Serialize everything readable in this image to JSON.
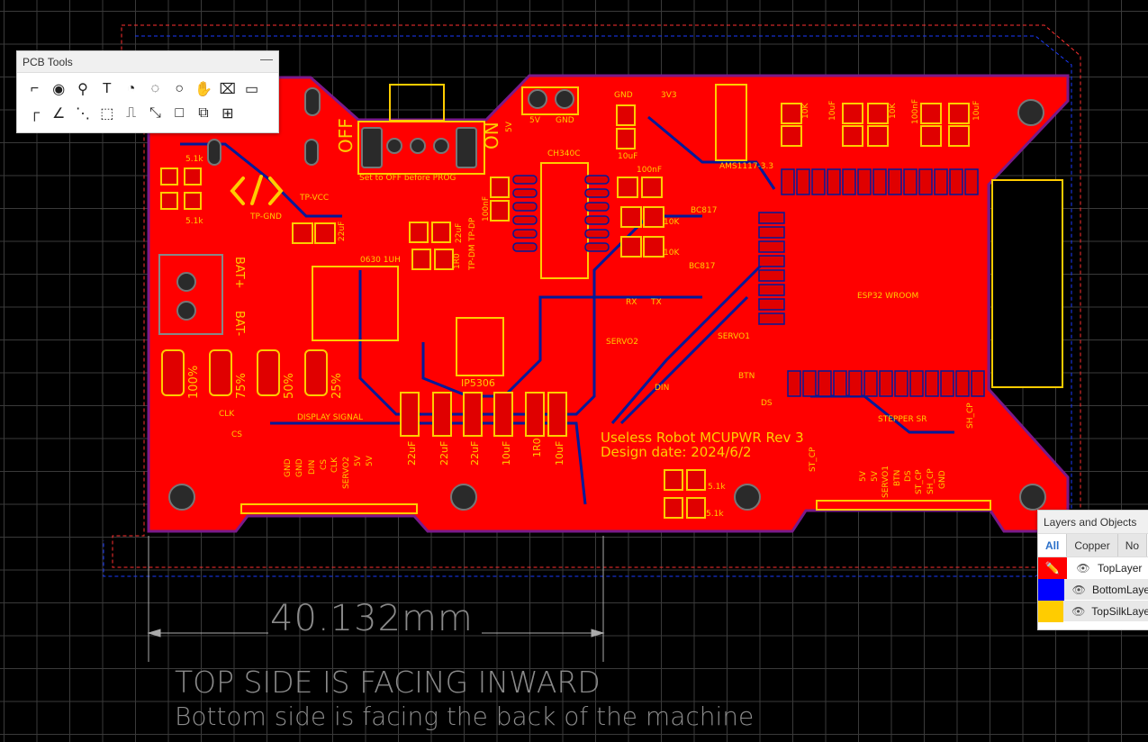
{
  "colors": {
    "top_layer": "#ff0000",
    "bottom_layer": "#0000ff",
    "top_silk": "#ffcc00",
    "board_outline": "#7a1a8a",
    "background": "#000000"
  },
  "pcb_tools": {
    "title": "PCB Tools",
    "minimize_icon": "minus-icon",
    "tools": [
      {
        "name": "route-track-icon",
        "glyph": "⌐"
      },
      {
        "name": "via-icon",
        "glyph": "◉"
      },
      {
        "name": "pad-icon",
        "glyph": "⚲"
      },
      {
        "name": "text-icon",
        "glyph": "T"
      },
      {
        "name": "arc-icon",
        "glyph": "◔"
      },
      {
        "name": "arc-center-icon",
        "glyph": "◌"
      },
      {
        "name": "circle-icon",
        "glyph": "○"
      },
      {
        "name": "pan-hand-icon",
        "glyph": "✋"
      },
      {
        "name": "pad-cross-icon",
        "glyph": "⌧"
      },
      {
        "name": "image-icon",
        "glyph": "▭"
      },
      {
        "name": "dimension-icon",
        "glyph": "┌"
      },
      {
        "name": "angle-icon",
        "glyph": "∠"
      },
      {
        "name": "connect-icon",
        "glyph": "⋱"
      },
      {
        "name": "region-icon",
        "glyph": "⬚"
      },
      {
        "name": "polygon-icon",
        "glyph": "⎍"
      },
      {
        "name": "measure-icon",
        "glyph": "⤡"
      },
      {
        "name": "rectangle-icon",
        "glyph": "□"
      },
      {
        "name": "group-icon",
        "glyph": "⧉"
      },
      {
        "name": "table-icon",
        "glyph": "⊞"
      }
    ]
  },
  "layers_panel": {
    "title": "Layers and Objects",
    "tabs": [
      "All",
      "Copper",
      "No"
    ],
    "layers": [
      {
        "name": "TopLayer",
        "color": "#ff0000",
        "active": true
      },
      {
        "name": "BottomLayer",
        "color": "#0000ff"
      },
      {
        "name": "TopSilkLayer",
        "color": "#ffcc00"
      }
    ]
  },
  "dimension": {
    "text": "40.132mm"
  },
  "notes": {
    "line1": "TOP SIDE IS FACING INWARD",
    "line2": "Bottom side is facing the back of the machine"
  },
  "silk": [
    "OFF",
    "ON",
    "Set to OFF before PROG",
    "5V",
    "5V",
    "GND",
    "CH340C",
    "5.1k",
    "5.1k",
    "TP-VCC",
    "TP-GND",
    "22uF",
    "22uF",
    "100nF",
    "TP-DP",
    "TP-DM",
    "0630 1UH",
    "1R0",
    "BAT+",
    "BAT-",
    "100%",
    "75%",
    "50%",
    "25%",
    "CLK",
    "CS",
    "DISPLAY SIGNAL",
    "GND",
    "GND",
    "DIN",
    "CS",
    "CLK",
    "SERVO2",
    "5V",
    "5V",
    "IP5306",
    "22uF",
    "22uF",
    "22uF",
    "10uF",
    "1R0",
    "10uF",
    "GND",
    "3V3",
    "10uF",
    "100nF",
    "AMS1117-3.3",
    "10K",
    "10uF",
    "10K",
    "100nF",
    "10uF",
    "BC817",
    "10K",
    "10K",
    "BC817",
    "ESP32 WROOM",
    "RX",
    "TX",
    "SERVO2",
    "SERVO1",
    "BTN",
    "DIN",
    "DS",
    "Useless Robot MCUPWR Rev 3",
    "Design date: 2024/6/2",
    "5.1k",
    "5.1k",
    "STEPPER SR",
    "ST_CP",
    "SH_CP",
    "5V",
    "5V",
    "SERVO1",
    "BTN",
    "DS",
    "ST_CP",
    "SH_CP",
    "GND"
  ]
}
